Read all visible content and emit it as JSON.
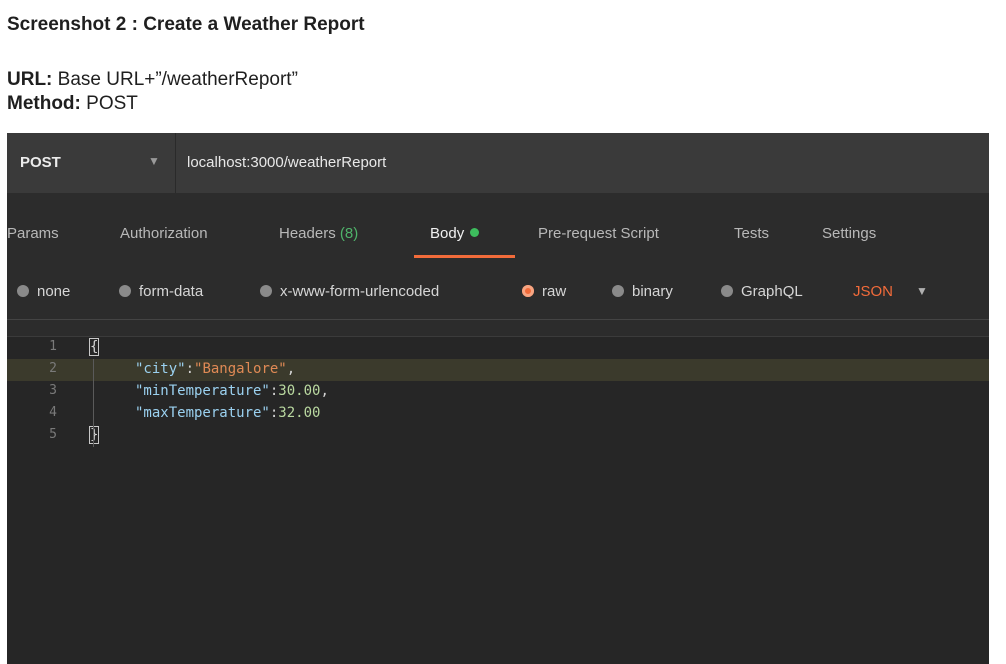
{
  "doc": {
    "title": "Screenshot 2 : Create a Weather Report",
    "url_key": "URL:",
    "url_value": " Base URL+”/weatherReport”",
    "method_key": "Method:",
    "method_value": " POST"
  },
  "request": {
    "method": "POST",
    "url": "localhost:3000/weatherReport"
  },
  "tabs": {
    "params": "Params",
    "authorization": "Authorization",
    "headers": "Headers",
    "headers_count": "(8)",
    "body": "Body",
    "prerequest": "Pre-request Script",
    "tests": "Tests",
    "settings": "Settings",
    "active": "Body"
  },
  "body_options": {
    "none": "none",
    "form_data": "form-data",
    "urlencoded": "x-www-form-urlencoded",
    "raw": "raw",
    "binary": "binary",
    "graphql": "GraphQL",
    "selected": "raw",
    "language": "JSON"
  },
  "editor": {
    "line_numbers": [
      "1",
      "2",
      "3",
      "4",
      "5"
    ],
    "open_brace": "{",
    "close_brace": "}",
    "line2_key": "\"city\"",
    "line2_sep": ":",
    "line2_value": "\"Bangalore\"",
    "line2_end": ",",
    "line3_key": "\"minTemperature\"",
    "line3_sep": ":",
    "line3_value": "30.00",
    "line3_end": ",",
    "line4_key": "\"maxTemperature\"",
    "line4_sep": ":",
    "line4_value": "32.00"
  },
  "colors": {
    "accent": "#f26b3a",
    "status_green": "#3dbd5d",
    "panel_bg": "#2c2c2c",
    "editor_bg": "#262626"
  }
}
